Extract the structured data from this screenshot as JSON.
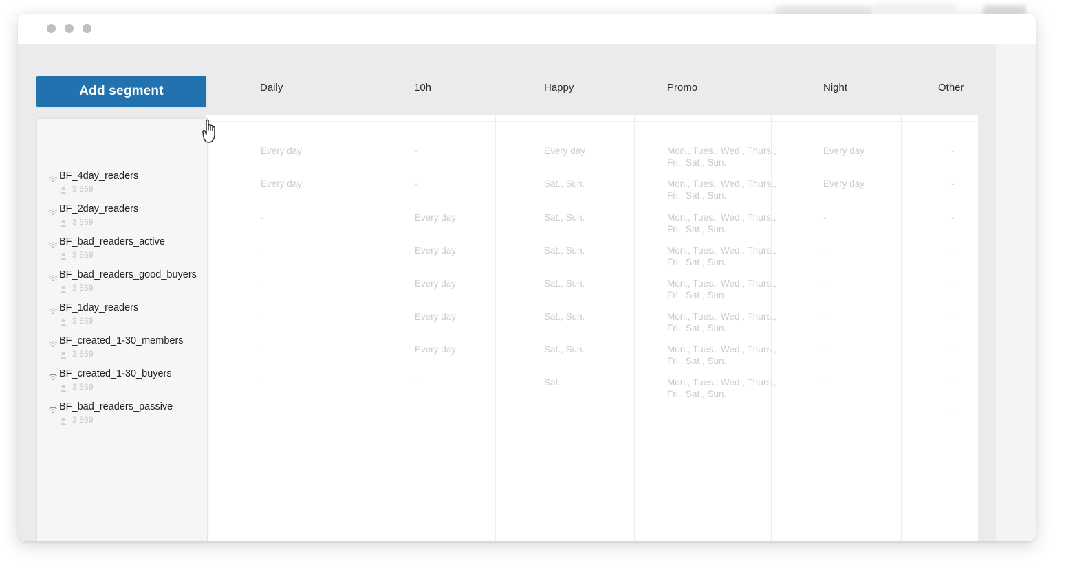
{
  "window": {
    "traffic_lights": [
      "close",
      "minimize",
      "zoom"
    ]
  },
  "toolbar": {
    "add_segment_label": "Add segment",
    "add_segment_color": "#2272b0",
    "cursor": "pointer-hand-cursor"
  },
  "table": {
    "columns": [
      "Daily",
      "10h",
      "Happy",
      "Promo",
      "Night",
      "Other"
    ],
    "rows": [
      {
        "Daily": "Every day",
        "10h": "-",
        "Happy": "Every day",
        "Promo": "Mon., Tues., Wed., Thurs., Fri., Sat., Sun.",
        "Night": "Every day",
        "Other": "-"
      },
      {
        "Daily": "Every day",
        "10h": "-",
        "Happy": "Sat., Sun.",
        "Promo": "Mon., Tues., Wed., Thurs., Fri., Sat., Sun.",
        "Night": "Every day",
        "Other": "-"
      },
      {
        "Daily": "-",
        "10h": "Every day",
        "Happy": "Sat., Sun.",
        "Promo": "Mon., Tues., Wed., Thurs., Fri., Sat., Sun.",
        "Night": "-",
        "Other": "-"
      },
      {
        "Daily": "-",
        "10h": "Every day",
        "Happy": "Sat., Sun.",
        "Promo": "Mon., Tues., Wed., Thurs., Fri., Sat., Sun.",
        "Night": "-",
        "Other": "-"
      },
      {
        "Daily": "-",
        "10h": "Every day",
        "Happy": "Sat., Sun.",
        "Promo": "Mon., Tues., Wed., Thurs., Fri., Sat., Sun.",
        "Night": "-",
        "Other": "-"
      },
      {
        "Daily": "-",
        "10h": "Every day",
        "Happy": "Sat., Sun.",
        "Promo": "Mon., Tues., Wed., Thurs., Fri., Sat., Sun.",
        "Night": "-",
        "Other": "-"
      },
      {
        "Daily": "-",
        "10h": "Every day",
        "Happy": "Sat., Sun.",
        "Promo": "Mon., Tues., Wed., Thurs., Fri., Sat., Sun.",
        "Night": "-",
        "Other": "-"
      },
      {
        "Daily": "-",
        "10h": "-",
        "Happy": "Sat.",
        "Promo": "Mon., Tues., Wed., Thurs., Fri., Sat., Sun.",
        "Night": "-",
        "Other": "-"
      },
      {
        "Daily": "",
        "10h": "",
        "Happy": "",
        "Promo": "",
        "Night": "",
        "Other": "-"
      }
    ]
  },
  "segments": {
    "items": [
      {
        "name": "BF_4day_readers",
        "count": "3 569"
      },
      {
        "name": "BF_2day_readers",
        "count": "3 569"
      },
      {
        "name": "BF_bad_readers_active",
        "count": "3 569"
      },
      {
        "name": "BF_bad_readers_good_buyers",
        "count": "3 569"
      },
      {
        "name": "BF_1day_readers",
        "count": "3 569"
      },
      {
        "name": "BF_created_1-30_members",
        "count": "3 569"
      },
      {
        "name": "BF_created_1-30_buyers",
        "count": "3 569"
      },
      {
        "name": "BF_bad_readers_passive",
        "count": "3 569"
      }
    ]
  }
}
